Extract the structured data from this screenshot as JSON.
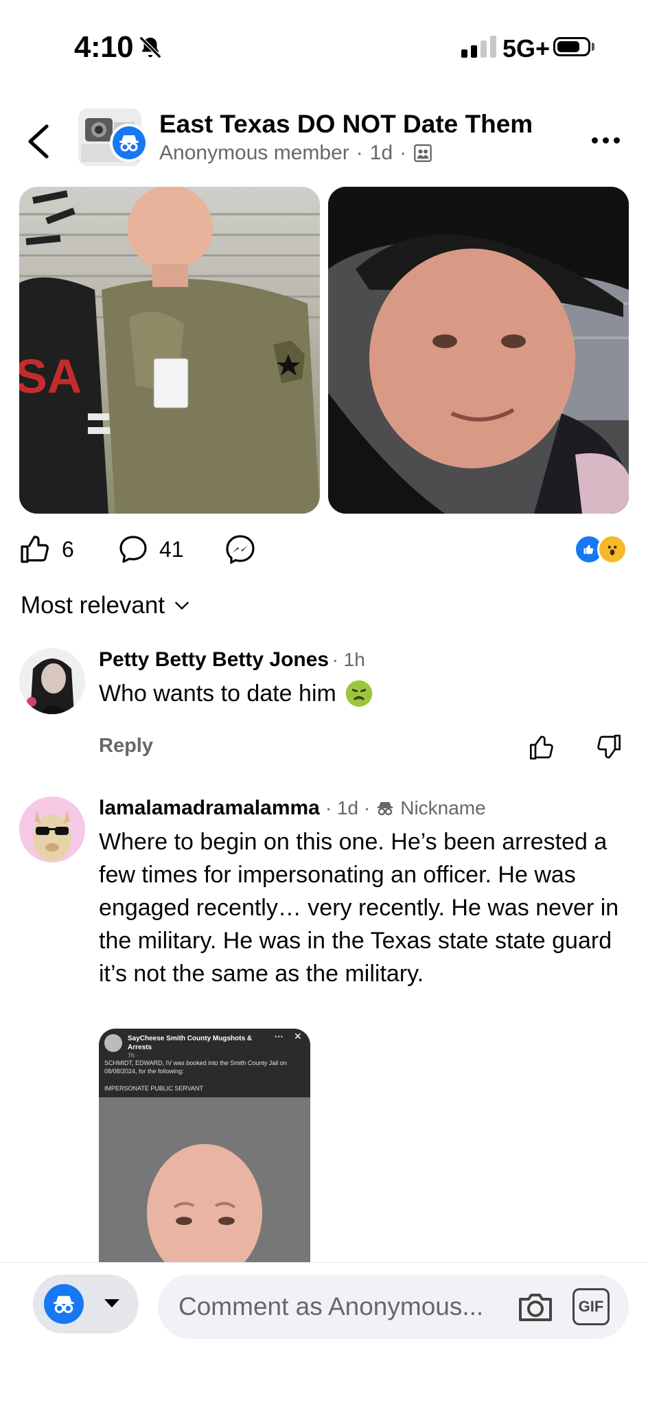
{
  "status_bar": {
    "time": "4:10",
    "network": "5G+"
  },
  "header": {
    "group_name": "East Texas DO NOT Date Them",
    "author": "Anonymous member",
    "age": "1d",
    "separator": "·"
  },
  "post": {
    "likes": "6",
    "comments": "41"
  },
  "sort": {
    "label": "Most relevant"
  },
  "comments": [
    {
      "name": "Petty Betty Betty Jones",
      "time": "· 1h",
      "text": "Who wants to date him",
      "reply_label": "Reply"
    },
    {
      "name": "lamalamadramalamma",
      "time": "· 1d ·",
      "badge": "Nickname",
      "text": "Where to begin on this one. He’s been arrested a few times for impersonating an officer. He was engaged recently… very recently. He was never in the military. He was in the Texas state state guard it’s not the same as the military.",
      "attachment": {
        "title": "SayCheese Smith County Mugshots & Arrests",
        "time": "7h · ",
        "description": "SCHMIDT, EDWARD, IV was booked into the Smith County Jail on 08/08/2024, for the following:",
        "charge": "IMPERSONATE PUBLIC SERVANT"
      }
    }
  ],
  "composer": {
    "placeholder": "Comment as Anonymous...",
    "gif_label": "GIF"
  },
  "colors": {
    "accent": "#1877f2",
    "secondary_text": "#65676b"
  }
}
